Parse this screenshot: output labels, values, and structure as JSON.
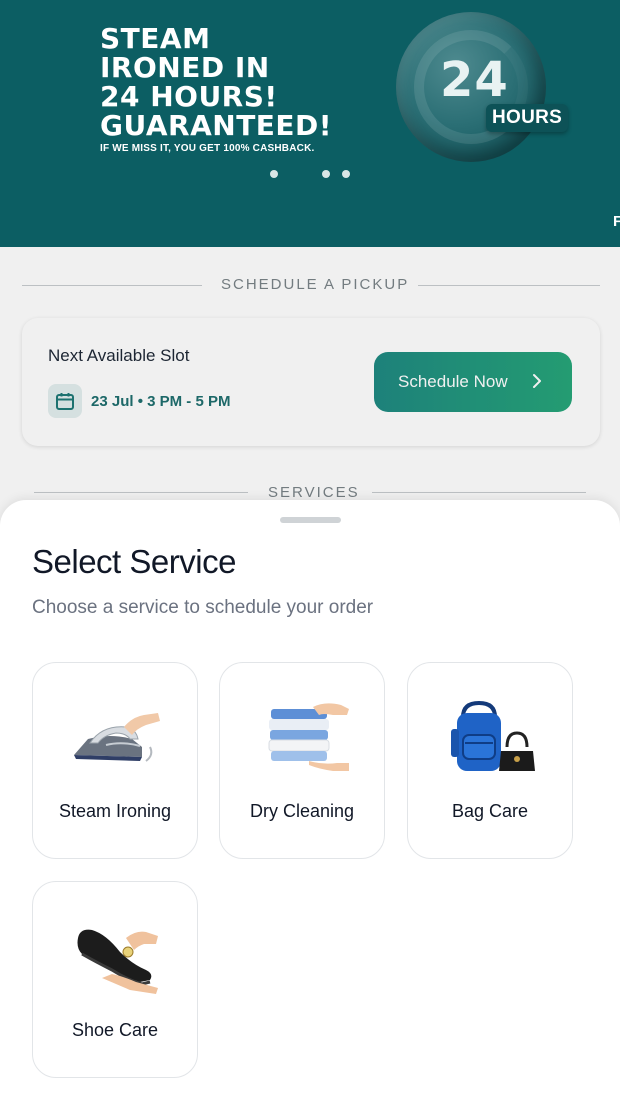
{
  "banner": {
    "headline_lines": [
      "STEAM",
      "IRONED IN",
      "24 HOURS!",
      "GUARANTEED!"
    ],
    "subtext": "IF WE MISS IT, YOU GET 100% CASHBACK.",
    "badge_number": "24",
    "badge_label": "HOURS",
    "next_slide_peek": "F"
  },
  "schedule": {
    "section_title": "SCHEDULE A PICKUP",
    "slot_title": "Next Available Slot",
    "slot_time": "23 Jul • 3 PM - 5 PM",
    "button_label": "Schedule Now"
  },
  "services_section": {
    "title": "SERVICES"
  },
  "sheet": {
    "title": "Select Service",
    "subtitle": "Choose a service to schedule your order",
    "services": [
      {
        "label": "Steam Ironing",
        "icon": "steam-iron-icon"
      },
      {
        "label": "Dry Cleaning",
        "icon": "folded-clothes-icon"
      },
      {
        "label": "Bag Care",
        "icon": "bags-icon"
      },
      {
        "label": "Shoe Care",
        "icon": "shoe-polish-icon"
      }
    ]
  },
  "colors": {
    "banner_bg": "#0c5e63",
    "primary_button_start": "#1f8a82",
    "primary_button_end": "#27a67a",
    "accent_text": "#1f6f6f"
  }
}
